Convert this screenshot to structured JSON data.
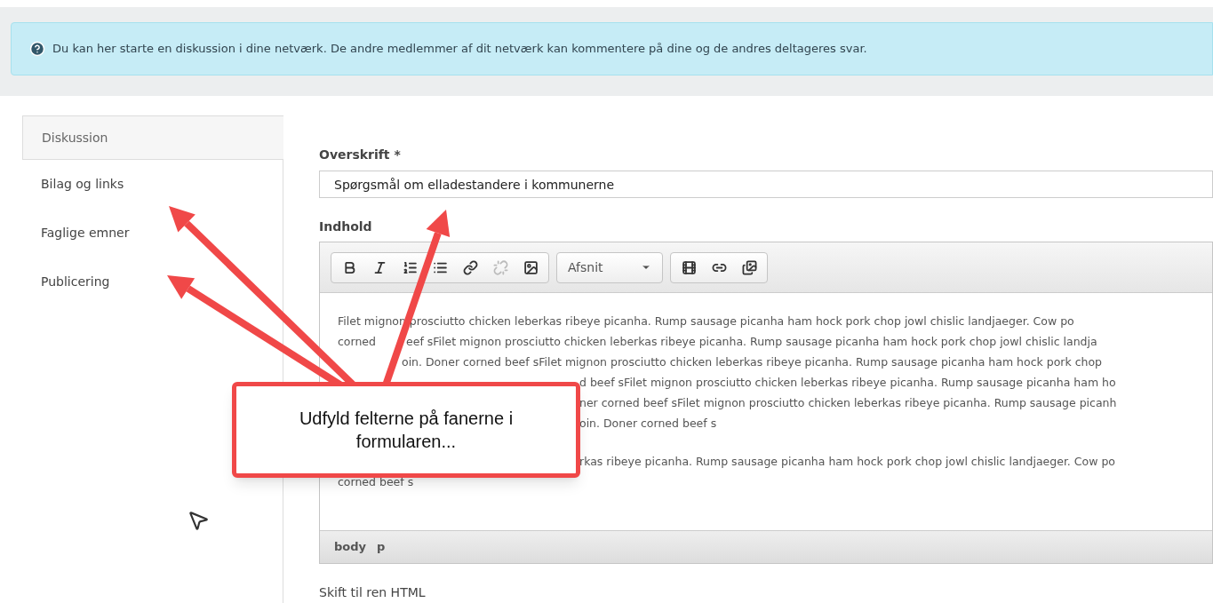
{
  "info_banner": {
    "text": "Du kan her starte en diskussion i dine netværk. De andre medlemmer af dit netværk kan kommentere på dine og de andres deltageres svar."
  },
  "tabs": [
    {
      "label": "Diskussion",
      "selected": true
    },
    {
      "label": "Bilag og links",
      "selected": false
    },
    {
      "label": "Faglige emner",
      "selected": false
    },
    {
      "label": "Publicering",
      "selected": false
    }
  ],
  "title_field": {
    "label": "Overskrift *",
    "value": "Spørgsmål om elladestandere i kommunerne"
  },
  "content_editor": {
    "label": "Indhold",
    "toolbar": [
      [
        {
          "kind": "bold",
          "disabled": false
        },
        {
          "kind": "italic",
          "disabled": false
        },
        {
          "kind": "numbered-list",
          "disabled": false
        },
        {
          "kind": "bullet-list",
          "disabled": false
        },
        {
          "kind": "link",
          "disabled": false
        },
        {
          "kind": "unlink",
          "disabled": true
        },
        {
          "kind": "image",
          "disabled": false
        }
      ],
      [
        {
          "kind": "format",
          "label": "Afsnit"
        }
      ],
      [
        {
          "kind": "video-add",
          "disabled": false
        },
        {
          "kind": "link-add",
          "disabled": false
        },
        {
          "kind": "gallery",
          "disabled": false
        }
      ]
    ],
    "paragraphs": [
      [
        {
          "kind": "full",
          "pieces": [
            "Filet mignon prosciutto chicken leberkas ribeye picanha. Rump sausage picanha ham hock pork chop jowl chislic landjaeger. Cow po"
          ]
        },
        {
          "kind": "full",
          "pieces": [
            "corned",
            "eef sFilet mignon prosciutto chicken leberkas ribeye picanha. Rump sausage picanha ham hock pork chop jowl chislic landja"
          ]
        },
        {
          "kind": "after-arrow",
          "pieces": [
            "oin. Doner corned beef sFilet mignon prosciutto chicken leberkas ribeye picanha. Rump sausage picanha ham hock pork chop"
          ]
        },
        {
          "kind": "after-callout",
          "pieces": [
            "d beef sFilet mignon prosciutto chicken leberkas ribeye picanha. Rump sausage picanha ham ho"
          ]
        },
        {
          "kind": "after-callout",
          "pieces": [
            "ner corned beef sFilet mignon prosciutto chicken leberkas ribeye picanha. Rump sausage picanh"
          ]
        },
        {
          "kind": "after-callout",
          "pieces": [
            "oin. Doner corned beef s"
          ]
        }
      ],
      [
        {
          "kind": "after-callout",
          "pieces": [
            "rkas ribeye picanha. Rump sausage picanha ham hock pork chop jowl chislic landjaeger. Cow po"
          ]
        },
        {
          "kind": "full",
          "pieces": [
            "corned beef s"
          ]
        }
      ]
    ],
    "path": [
      "body",
      "p"
    ]
  },
  "html_toggle": "Skift til ren HTML",
  "callout": {
    "text": "Udfyld felterne på fanerne i formularen..."
  }
}
